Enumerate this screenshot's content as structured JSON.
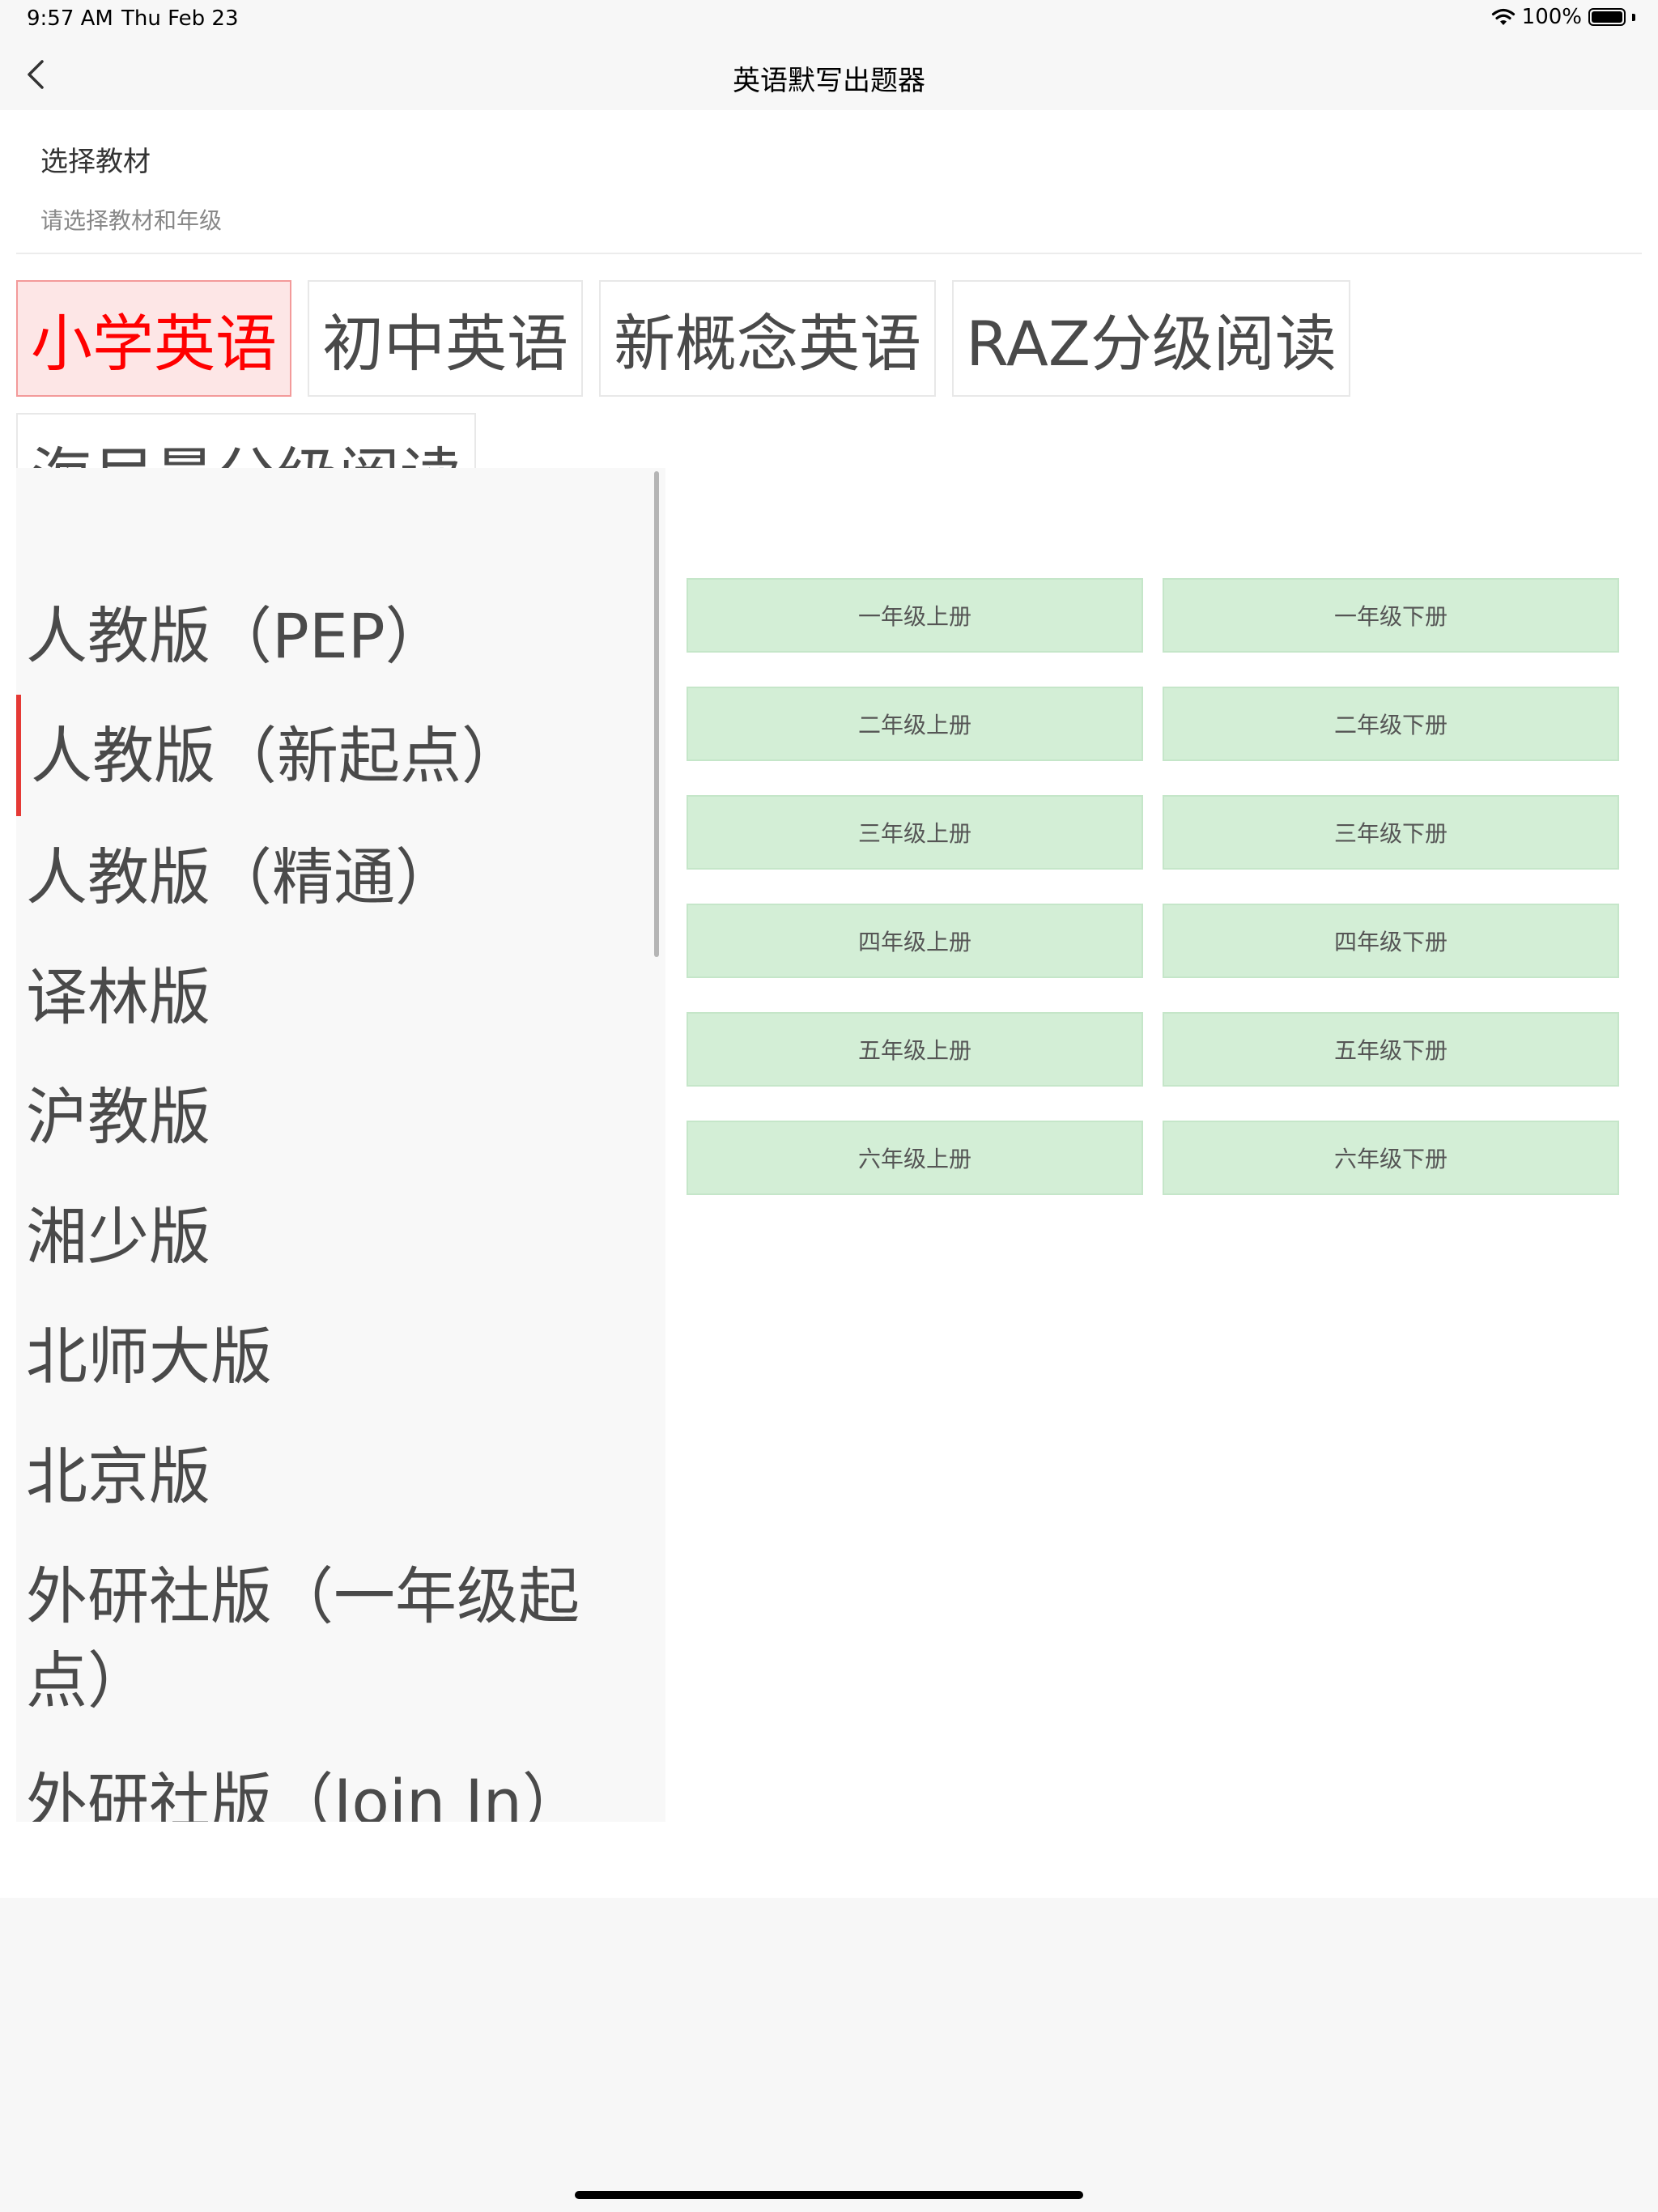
{
  "status_bar": {
    "time": "9:57 AM",
    "date": "Thu Feb 23",
    "battery": "100%"
  },
  "nav": {
    "title": "英语默写出题器"
  },
  "section": {
    "title": "选择教材",
    "subtitle": "请选择教材和年级"
  },
  "categories": [
    {
      "label": "小学英语",
      "active": true
    },
    {
      "label": "初中英语",
      "active": false
    },
    {
      "label": "新概念英语",
      "active": false
    },
    {
      "label": "RAZ分级阅读",
      "active": false
    },
    {
      "label": "海尼曼分级阅读",
      "active": false
    }
  ],
  "publishers": [
    {
      "label": "人教版（PEP）"
    },
    {
      "label": "人教版（新起点）"
    },
    {
      "label": "人教版（精通）"
    },
    {
      "label": "译林版"
    },
    {
      "label": "沪教版"
    },
    {
      "label": "湘少版"
    },
    {
      "label": "北师大版"
    },
    {
      "label": "北京版"
    },
    {
      "label": "外研社版（一年级起"
    },
    {
      "label": "点）"
    },
    {
      "label": "外研社版（Join In）"
    }
  ],
  "grades": [
    {
      "label": "一年级上册"
    },
    {
      "label": "一年级下册"
    },
    {
      "label": "二年级上册"
    },
    {
      "label": "二年级下册"
    },
    {
      "label": "三年级上册"
    },
    {
      "label": "三年级下册"
    },
    {
      "label": "四年级上册"
    },
    {
      "label": "四年级下册"
    },
    {
      "label": "五年级上册"
    },
    {
      "label": "五年级下册"
    },
    {
      "label": "六年级上册"
    },
    {
      "label": "六年级下册"
    }
  ],
  "colors": {
    "accent": "#ff0000",
    "active_bg": "#fde6e6",
    "grade_bg": "#d3eed6"
  }
}
